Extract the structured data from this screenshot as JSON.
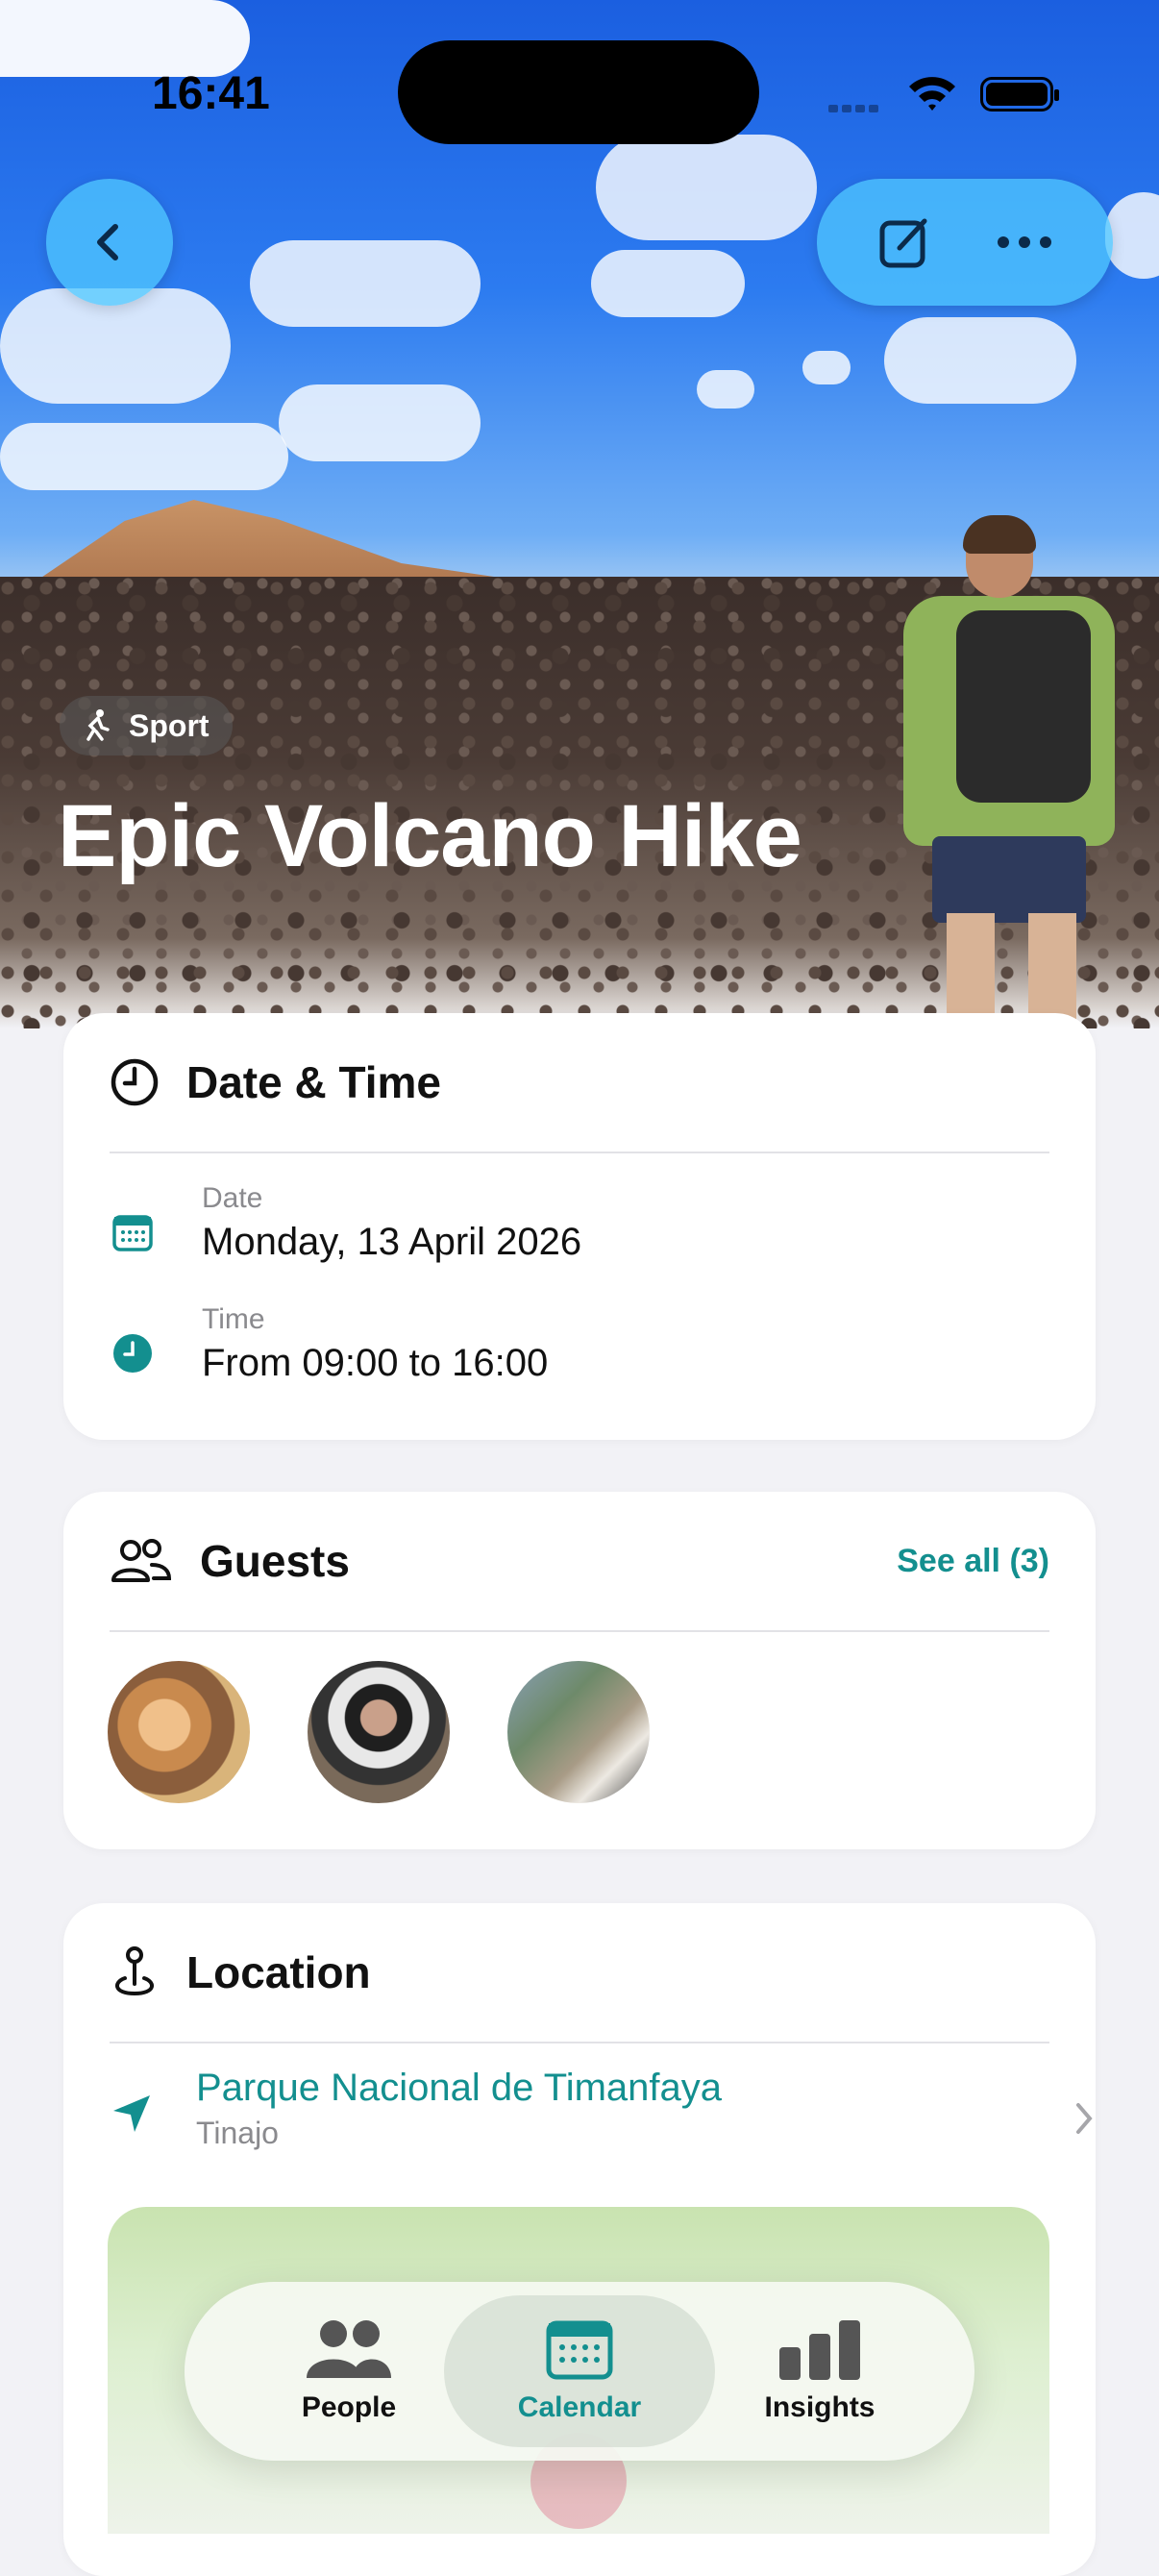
{
  "status_bar": {
    "time": "16:41"
  },
  "event": {
    "category": "Sport",
    "title": "Epic Volcano Hike"
  },
  "date_time": {
    "heading": "Date & Time",
    "date_label": "Date",
    "date_value": "Monday, 13 April 2026",
    "time_label": "Time",
    "time_value": "From 09:00 to 16:00"
  },
  "guests": {
    "heading": "Guests",
    "see_all": "See all (3)",
    "avatars": [
      "guest-1",
      "guest-2",
      "guest-3"
    ]
  },
  "location": {
    "heading": "Location",
    "name": "Parque Nacional de Timanfaya",
    "locality": "Tinajo"
  },
  "tabbar": {
    "items": [
      {
        "label": "People",
        "icon": "people-icon",
        "active": false
      },
      {
        "label": "Calendar",
        "icon": "calendar-icon",
        "active": true
      },
      {
        "label": "Insights",
        "icon": "bar-chart-icon",
        "active": false
      }
    ]
  },
  "colors": {
    "accent": "#138F8F",
    "background": "#F2F2F6",
    "glass_button": "#50C8FF"
  }
}
